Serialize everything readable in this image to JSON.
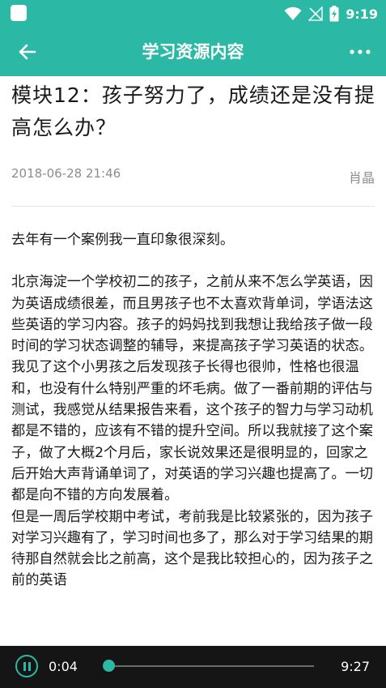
{
  "status_bar": {
    "time": "9:19",
    "icons": [
      "wifi-icon",
      "no-signal-icon",
      "battery-charging-icon"
    ]
  },
  "app_bar": {
    "title": "学习资源内容",
    "back_icon": "arrow-left-icon",
    "more_icon": "more-horizontal-icon"
  },
  "article": {
    "title": "模块12：孩子努力了，成绩还是没有提高怎么办？",
    "date": "2018-06-28 21:46",
    "author": "肖晶",
    "paragraphs": [
      "去年有一个案例我一直印象很深刻。",
      "北京海淀一个学校初二的孩子，之前从来不怎么学英语，因为英语成绩很差，而且男孩子也不太喜欢背单词，学语法这些英语的学习内容。孩子的妈妈找到我想让我给孩子做一段时间的学习状态调整的辅导，来提高孩子学习英语的状态。我见了这个小男孩之后发现孩子长得也很帅，性格也很温和，也没有什么特别严重的坏毛病。做了一番前期的评估与测试，我感觉从结果报告来看，这个孩子的智力与学习动机都是不错的，应该有不错的提升空间。所以我就接了这个案子，做了大概2个月后，家长说效果还是很明显的，回家之后开始大声背诵单词了，对英语的学习兴趣也提高了。一切都是向不错的方向发展着。",
      "但是一周后学校期中考试，考前我是比较紧张的，因为孩子对学习兴趣有了，学习时间也多了，那么对于学习结果的期待那自然就会比之前高，这个是我比较担心的，因为孩子之前的英语"
    ]
  },
  "player": {
    "current_time": "0:04",
    "total_time": "9:27",
    "progress": 0.007,
    "accent_color": "#2bb9a5"
  }
}
